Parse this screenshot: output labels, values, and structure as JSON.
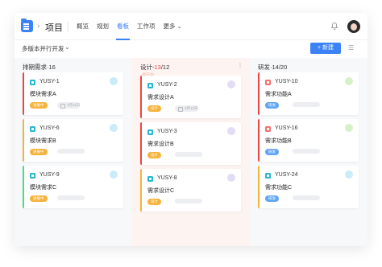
{
  "header": {
    "project_title": "项目",
    "tabs": [
      {
        "label": "概览"
      },
      {
        "label": "规划"
      },
      {
        "label": "看板"
      },
      {
        "label": "工作项"
      },
      {
        "label": "更多 ⌄"
      }
    ],
    "active_tab": "看板"
  },
  "toolbar": {
    "version_label": "多版本并行开发",
    "new_button_label": "+ 新建"
  },
  "columns": [
    {
      "prefix": "排期需求",
      "count": "16",
      "sep": "·",
      "total": "",
      "cards": [
        {
          "id": "YUSY-1",
          "title": "模块需求A",
          "badge": "进展中",
          "date": "3月11日",
          "icon_color": "#29b6d4",
          "avatar_color": "#c9ecf7",
          "bar_color": "#ef4444",
          "badge_color": "#f6b33c"
        },
        {
          "id": "YUSY-6",
          "title": "模块需求B",
          "badge": "进展中",
          "date": "",
          "icon_color": "#29b6d4",
          "avatar_color": "#c9ecf7",
          "bar_color": "#f6b33c",
          "badge_color": "#f6b33c"
        },
        {
          "id": "YUSY-9",
          "title": "模块需求C",
          "badge": "进展中",
          "date": "",
          "icon_color": "#29b6d4",
          "avatar_color": "#c9ecf7",
          "bar_color": "#4ade80",
          "badge_color": "#f6b33c"
        }
      ]
    },
    {
      "prefix": "设计",
      "count": "13",
      "sep": "-",
      "total": "/12",
      "tip": "进行中",
      "cards": [
        {
          "id": "YUSY-2",
          "title": "需求设计A",
          "badge": "设计",
          "date": "3月12日",
          "icon_color": "#29b6d4",
          "avatar_color": "#e3dcf6",
          "bar_color": "#ef4444",
          "badge_color": "#f6b33c"
        },
        {
          "id": "YUSY-3",
          "title": "需求设计B",
          "badge": "设计",
          "date": "",
          "icon_color": "#29b6d4",
          "avatar_color": "#e3dcf6",
          "bar_color": "#ef4444",
          "badge_color": "#f6b33c"
        },
        {
          "id": "YUSY-8",
          "title": "需求设计C",
          "badge": "设计",
          "date": "",
          "icon_color": "#29b6d4",
          "avatar_color": "#e3dcf6",
          "bar_color": "#f6b33c",
          "badge_color": "#f6b33c"
        }
      ]
    },
    {
      "prefix": "研发",
      "count": "14",
      "sep": "·",
      "total": "/20",
      "cards": [
        {
          "id": "YUSY-10",
          "title": "需求功能A",
          "badge": "研发",
          "date": "",
          "icon_color": "#f87171",
          "avatar_color": "#d8f0c8",
          "bar_color": "#ef4444",
          "badge_color": "#60a5fa"
        },
        {
          "id": "YUSY-16",
          "title": "需求功能B",
          "badge": "研发",
          "date": "",
          "icon_color": "#f87171",
          "avatar_color": "#d8f0c8",
          "bar_color": "#ef4444",
          "badge_color": "#60a5fa"
        },
        {
          "id": "YUSY-24",
          "title": "需求功能C",
          "badge": "研发",
          "date": "",
          "icon_color": "#29b6d4",
          "avatar_color": "#c9ecf7",
          "bar_color": "#f6b33c",
          "badge_color": "#60a5fa"
        }
      ]
    }
  ]
}
